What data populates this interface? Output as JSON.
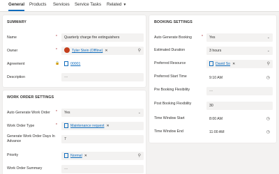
{
  "tabs": [
    {
      "label": "General"
    },
    {
      "label": "Products"
    },
    {
      "label": "Services"
    },
    {
      "label": "Service Tasks"
    },
    {
      "label": "Related"
    }
  ],
  "summary": {
    "title": "SUMMARY",
    "name_label": "Name",
    "name_value": "Quarterly charge fire extinguishers",
    "owner_label": "Owner",
    "owner_value": "Tyler Stein (Offline)",
    "agreement_label": "Agreement",
    "agreement_value": "00001",
    "description_label": "Description",
    "description_value": "---"
  },
  "work_order_settings": {
    "title": "WORK ORDER SETTINGS",
    "auto_generate_label": "Auto Generate Work Order",
    "auto_generate_value": "Yes",
    "type_label": "Work Order Type",
    "type_value": "Maintenance request",
    "days_label": "Generate Work Order Days In Advance",
    "days_value": "7",
    "priority_label": "Priority",
    "priority_value": "Normal",
    "summary_label": "Work Order Summary",
    "summary_value": "---"
  },
  "booking_settings": {
    "title": "BOOKING SETTINGS",
    "auto_booking_label": "Auto Generate Booking",
    "auto_booking_value": "Yes",
    "duration_label": "Estimated Duration",
    "duration_value": "3 hours",
    "resource_label": "Preferred Resource",
    "resource_value": "David So",
    "start_time_label": "Preferred Start Time",
    "start_time_value": "9:10 AM",
    "pre_flex_label": "Pre Booking Flexibility",
    "pre_flex_value": "---",
    "post_flex_label": "Post Booking Flexibility",
    "post_flex_value": "30",
    "window_start_label": "Time Window Start",
    "window_start_value": "8:00 AM",
    "window_end_label": "Time Window End",
    "window_end_value": "11:00 AM"
  },
  "colors": {
    "accent": "#0f6cbd",
    "required": "#a4262c",
    "avatar": "#c43e1c"
  }
}
